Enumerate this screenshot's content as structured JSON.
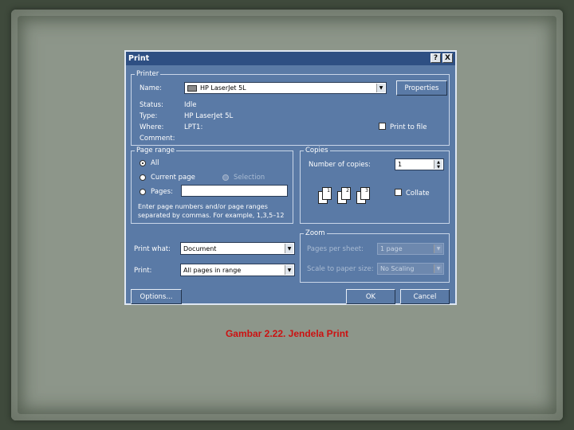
{
  "dialog": {
    "title": "Print",
    "help_button": "?",
    "close_button": "X"
  },
  "printer": {
    "group_title": "Printer",
    "name_label": "Name:",
    "name_value": "HP LaserJet 5L",
    "properties_label": "Properties",
    "status_label": "Status:",
    "status_value": "Idle",
    "type_label": "Type:",
    "type_value": "HP LaserJet 5L",
    "where_label": "Where:",
    "where_value": "LPT1:",
    "comment_label": "Comment:",
    "print_to_file_label": "Print to file"
  },
  "page_range": {
    "group_title": "Page range",
    "all_label": "All",
    "current_page_label": "Current page",
    "selection_label": "Selection",
    "pages_label": "Pages:",
    "pages_value": "",
    "help_text": "Enter page numbers and/or page ranges separated by commas. For example, 1,3,5–12"
  },
  "copies": {
    "group_title": "Copies",
    "number_label": "Number of copies:",
    "number_value": "1",
    "collate_label": "Collate",
    "collate_pages": [
      "1",
      "1",
      "2",
      "2",
      "3",
      "3"
    ]
  },
  "print_what": {
    "label": "Print what:",
    "value": "Document"
  },
  "print": {
    "label": "Print:",
    "value": "All pages in range"
  },
  "zoom": {
    "group_title": "Zoom",
    "pages_per_sheet_label": "Pages per sheet:",
    "pages_per_sheet_value": "1 page",
    "scale_label": "Scale to paper size:",
    "scale_value": "No Scaling"
  },
  "buttons": {
    "options": "Options...",
    "ok": "OK",
    "cancel": "Cancel"
  },
  "caption": "Gambar 2.22. Jendela Print",
  "colors": {
    "dialog_bg": "#5a7aa6",
    "titlebar": "#2e4f83",
    "caption": "#cc1111",
    "slide_bg": "#8d968a"
  }
}
